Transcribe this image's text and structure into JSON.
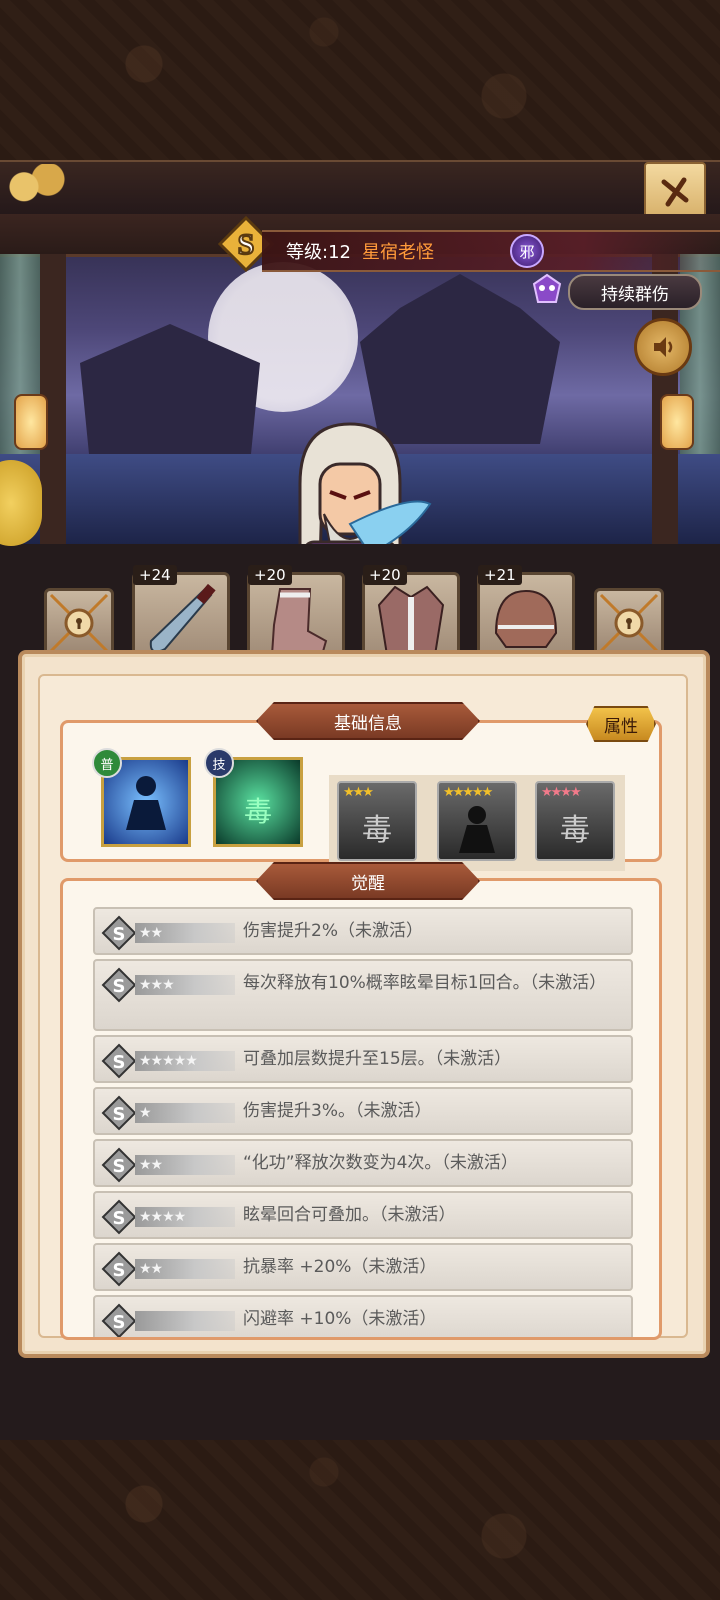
{
  "header": {
    "level_text": "等级:12",
    "hero_name": "星宿老怪",
    "faction": "邪",
    "skill_tag": "持续群伤"
  },
  "equipment": [
    {
      "name": "dagger",
      "plus": "+24"
    },
    {
      "name": "boots",
      "plus": "+20"
    },
    {
      "name": "armor",
      "plus": "+20"
    },
    {
      "name": "helmet",
      "plus": "+21"
    }
  ],
  "basic_info": {
    "title": "基础信息",
    "attr_button": "属性",
    "skills": [
      {
        "tag": "普",
        "tag_color": "#2f8a3a"
      },
      {
        "tag": "技",
        "tag_color": "#2a3a6a",
        "glyph": "毒"
      }
    ],
    "awaken_cards": [
      {
        "stars": "★★★",
        "star_color": "#f2c02a",
        "glyph": "毒"
      },
      {
        "stars": "★★★★★",
        "star_color": "#f2c02a",
        "glyph": ""
      },
      {
        "stars": "★★★★",
        "star_color": "#f27a8a",
        "glyph": "毒"
      }
    ]
  },
  "awaken": {
    "title": "觉醒",
    "rows": [
      {
        "stars": "★★",
        "text": "伤害提升2%（未激活）"
      },
      {
        "stars": "★★★",
        "text": "每次释放有10%概率眩晕目标1回合。（未激活）"
      },
      {
        "stars": "★★★★★",
        "text": "可叠加层数提升至15层。（未激活）"
      },
      {
        "stars": "★",
        "text": "伤害提升3%。（未激活）"
      },
      {
        "stars": "★★",
        "text": "“化功”释放次数变为4次。（未激活）"
      },
      {
        "stars": "★★★★",
        "text": "眩晕回合可叠加。（未激活）"
      },
      {
        "stars": "★★",
        "text": "抗暴率 +20%（未激活）"
      },
      {
        "stars": "",
        "text": "闪避率 +10%（未激活）"
      }
    ]
  }
}
